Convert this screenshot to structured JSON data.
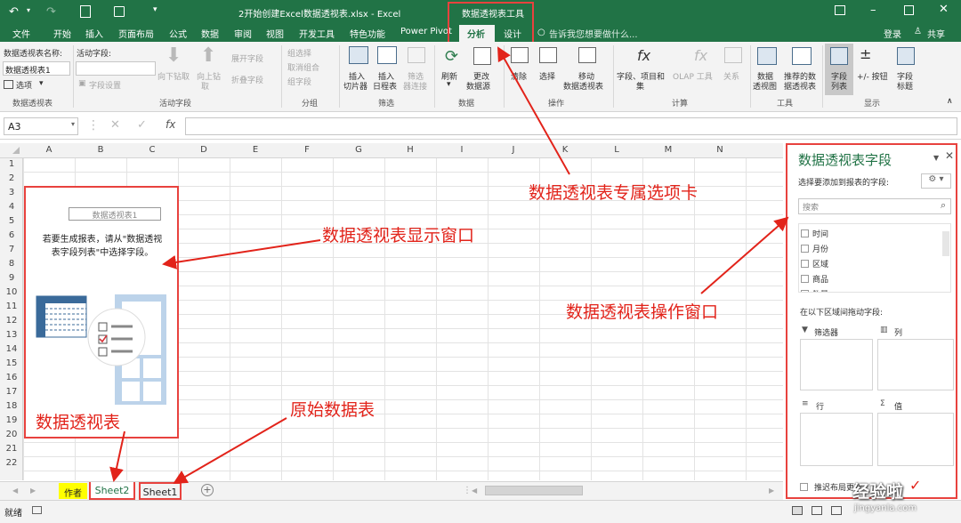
{
  "title": {
    "filename": "2开始创建Excel数据透视表.xlsx - Excel",
    "context_tools": "数据透视表工具",
    "login": "登录",
    "share": "共享"
  },
  "tabs": [
    "文件",
    "开始",
    "插入",
    "页面布局",
    "公式",
    "数据",
    "审阅",
    "视图",
    "开发工具",
    "特色功能",
    "Power Pivot",
    "分析",
    "设计"
  ],
  "tell_me": "告诉我您想要做什么...",
  "ribbon": {
    "pt_name_label": "数据透视表名称:",
    "pt_name_value": "数据透视表1",
    "options": "选项",
    "group_pt": "数据透视表",
    "active_field_label": "活动字段:",
    "field_settings": "字段设置",
    "drill_down": "向下钻取",
    "drill_up": "向上钻",
    "drill_up2": "取",
    "expand_field": "展开字段",
    "collapse_field": "折叠字段",
    "group_active": "活动字段",
    "group_selection": "组选择",
    "ungroup": "取消组合",
    "group_field": "组字段",
    "group_group": "分组",
    "insert_slicer_1": "插入",
    "insert_slicer_2": "切片器",
    "insert_timeline_1": "插入",
    "insert_timeline_2": "日程表",
    "filter_conn_1": "筛选",
    "filter_conn_2": "器连接",
    "group_filter": "筛选",
    "refresh": "刷新",
    "change_source_1": "更改",
    "change_source_2": "数据源",
    "group_data": "数据",
    "clear": "清除",
    "select": "选择",
    "move_1": "移动",
    "move_2": "数据透视表",
    "group_actions": "操作",
    "fields_items_1": "字段、项目和",
    "fields_items_2": "集",
    "olap": "OLAP 工具",
    "relations": "关系",
    "group_calc": "计算",
    "pivotchart_1": "数据",
    "pivotchart_2": "透视图",
    "recommended_1": "推荐的数",
    "recommended_2": "据透视表",
    "group_tools": "工具",
    "field_list_1": "字段",
    "field_list_2": "列表",
    "buttons": "+/- 按钮",
    "field_headers_1": "字段",
    "field_headers_2": "标题",
    "group_show": "显示"
  },
  "formula_bar": {
    "name_box": "A3",
    "fx": "fx"
  },
  "columns": [
    "A",
    "B",
    "C",
    "D",
    "E",
    "F",
    "G",
    "H",
    "I",
    "J",
    "K",
    "L",
    "M",
    "N"
  ],
  "rows": [
    "1",
    "2",
    "3",
    "4",
    "5",
    "6",
    "7",
    "8",
    "9",
    "10",
    "11",
    "12",
    "13",
    "14",
    "15",
    "16",
    "17",
    "18",
    "19",
    "20",
    "21",
    "22"
  ],
  "pivot_placeholder": {
    "title": "数据透视表1",
    "line1": "若要生成报表，请从\"数据透视",
    "line2": "表字段列表\"中选择字段。"
  },
  "sheets": {
    "author": "作者",
    "sheet2": "Sheet2",
    "sheet1": "Sheet1"
  },
  "status": {
    "ready": "就绪"
  },
  "pane": {
    "title": "数据透视表字段",
    "choose_label": "选择要添加到报表的字段:",
    "search_placeholder": "搜索",
    "fields": [
      "时间",
      "月份",
      "区域",
      "商品",
      "数量"
    ],
    "drag_label": "在以下区域间拖动字段:",
    "filters": "筛选器",
    "columns": "列",
    "rows": "行",
    "values": "值",
    "defer": "推迟布局更新"
  },
  "annotations": {
    "context_tab": "数据透视表专属选项卡",
    "display_window": "数据透视表显示窗口",
    "operate_window": "数据透视表操作窗口",
    "raw_data": "原始数据表",
    "pivot_table": "数据透视表"
  },
  "watermark": {
    "brand": "经验啦",
    "url": "jingyanla.com"
  },
  "colors": {
    "excel_green": "#217346",
    "annotation_red": "#e2231a",
    "author_tab": "#ffff00"
  }
}
